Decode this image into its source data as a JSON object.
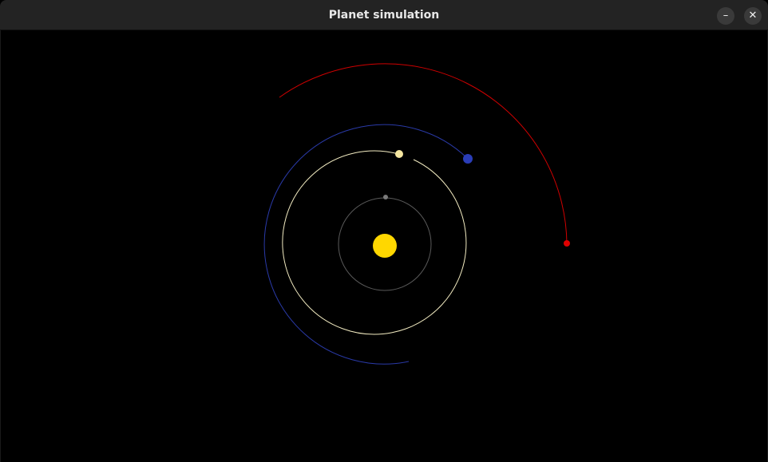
{
  "window": {
    "title": "Planet simulation",
    "minimize_glyph": "–",
    "close_glyph": "✕"
  },
  "simulation": {
    "background_color": "#000000",
    "sun": {
      "name": "sun",
      "color": "#ffd700"
    },
    "planets": [
      {
        "name": "planet-gray",
        "color": "#7a7a7a",
        "orbit_color": "#5a5a5a"
      },
      {
        "name": "planet-yellow",
        "color": "#f5e6a0",
        "orbit_color": "#f3ecc2"
      },
      {
        "name": "planet-blue",
        "color": "#2a3db8",
        "orbit_color": "#2a3aa8"
      },
      {
        "name": "planet-red",
        "color": "#e00000",
        "orbit_color": "#d00000"
      }
    ]
  }
}
